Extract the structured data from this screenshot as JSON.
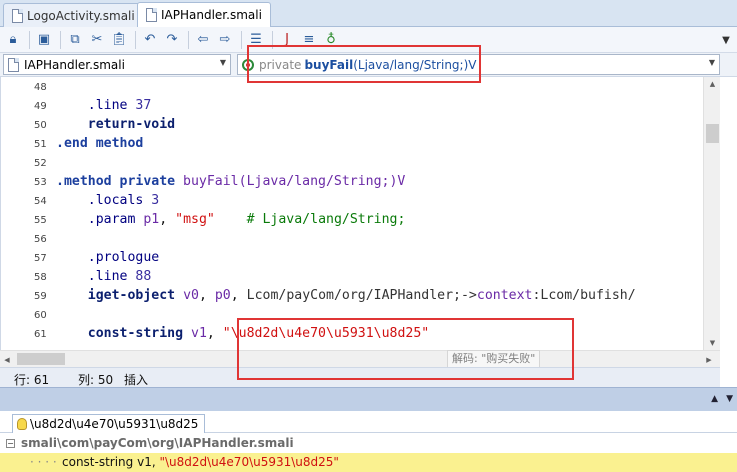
{
  "tabs": [
    {
      "label": "LogoActivity.smali",
      "active": false
    },
    {
      "label": "IAPHandler.smali",
      "active": true
    }
  ],
  "toolbar": {
    "icons": [
      "lock-icon",
      "save-icon",
      "copy-icon",
      "cut-icon",
      "paste-icon",
      "undo-icon",
      "redo-icon",
      "back-icon",
      "forward-icon",
      "format-icon",
      "smali-to-java-icon",
      "list-icon",
      "decompile-icon"
    ],
    "overflow_icon": "chevron-down-icon"
  },
  "nav": {
    "class_combo": "IAPHandler.smali",
    "method_combo": {
      "modifier": "private",
      "name": "buyFail",
      "signature": "(Ljava/lang/String;)V"
    }
  },
  "code_lines": [
    {
      "n": "48",
      "parts": []
    },
    {
      "n": "49",
      "parts": [
        {
          "t": "    "
        },
        {
          "t": ".line",
          "c": "dir"
        },
        {
          "t": " "
        },
        {
          "t": "37",
          "c": "num"
        }
      ]
    },
    {
      "n": "50",
      "parts": [
        {
          "t": "    "
        },
        {
          "t": "return-void",
          "c": "inst"
        }
      ]
    },
    {
      "n": "51",
      "parts": [
        {
          "t": ".end method",
          "c": "kw"
        }
      ]
    },
    {
      "n": "52",
      "parts": []
    },
    {
      "n": "53",
      "parts": [
        {
          "t": ".method private",
          "c": "kw"
        },
        {
          "t": " "
        },
        {
          "t": "buyFail",
          "c": "ident"
        },
        {
          "t": "(Ljava/lang/String;)V",
          "c": "ident"
        }
      ]
    },
    {
      "n": "54",
      "parts": [
        {
          "t": "    "
        },
        {
          "t": ".locals",
          "c": "dir"
        },
        {
          "t": " "
        },
        {
          "t": "3",
          "c": "num"
        }
      ]
    },
    {
      "n": "55",
      "parts": [
        {
          "t": "    "
        },
        {
          "t": ".param",
          "c": "dir"
        },
        {
          "t": " "
        },
        {
          "t": "p1",
          "c": "ident"
        },
        {
          "t": ", "
        },
        {
          "t": "\"msg\"",
          "c": "str"
        },
        {
          "t": "    "
        },
        {
          "t": "# Ljava/lang/String;",
          "c": "cmt"
        }
      ]
    },
    {
      "n": "56",
      "parts": []
    },
    {
      "n": "57",
      "parts": [
        {
          "t": "    "
        },
        {
          "t": ".prologue",
          "c": "dir"
        }
      ]
    },
    {
      "n": "58",
      "parts": [
        {
          "t": "    "
        },
        {
          "t": ".line",
          "c": "dir"
        },
        {
          "t": " "
        },
        {
          "t": "88",
          "c": "num"
        }
      ]
    },
    {
      "n": "59",
      "parts": [
        {
          "t": "    "
        },
        {
          "t": "iget-object",
          "c": "inst"
        },
        {
          "t": " "
        },
        {
          "t": "v0",
          "c": "ident"
        },
        {
          "t": ", "
        },
        {
          "t": "p0",
          "c": "ident"
        },
        {
          "t": ", "
        },
        {
          "t": "Lcom/payCom/org/IAPHandler;->",
          "c": "cls"
        },
        {
          "t": "context",
          "c": "ident"
        },
        {
          "t": ":Lcom/bufish/",
          "c": "cls"
        }
      ]
    },
    {
      "n": "60",
      "parts": []
    },
    {
      "n": "61",
      "parts": [
        {
          "t": "    "
        },
        {
          "t": "const-string",
          "c": "inst"
        },
        {
          "t": " "
        },
        {
          "t": "v1",
          "c": "ident"
        },
        {
          "t": ", "
        },
        {
          "t": "\"\\u8d2d\\u4e70\\u5931\\u8d25\"",
          "c": "str"
        }
      ]
    }
  ],
  "tooltip": "解码: \"购买失败\"",
  "status": {
    "row": "行: 61",
    "col": "列: 50",
    "mode": "插入"
  },
  "search": {
    "tab_label": "\\u8d2d\\u4e70\\u5931\\u8d25",
    "file": "smali\\com\\payCom\\org\\IAPHandler.smali",
    "result_prefix": "const-string v1, ",
    "result_string": "\"\\u8d2d\\u4e70\\u5931\\u8d25\""
  },
  "colors": {
    "highlight_box": "#e03535",
    "result_bg": "#faf190",
    "string": "#d01010",
    "comment": "#0a7a0a"
  }
}
